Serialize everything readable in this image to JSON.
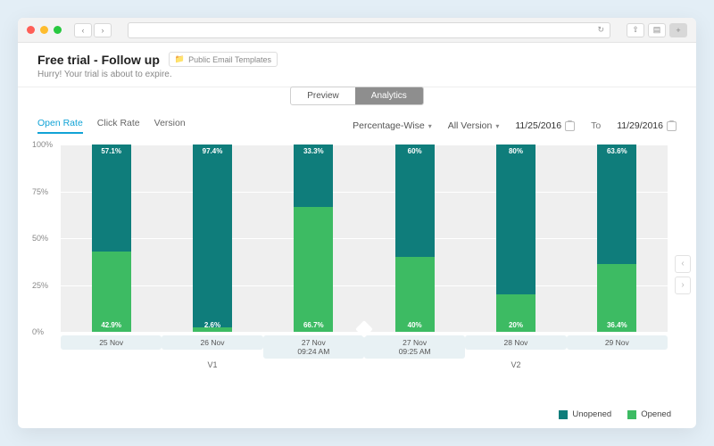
{
  "header": {
    "title": "Free trial - Follow up",
    "folder_label": "Public Email Templates",
    "subtitle": "Hurry! Your trial is about to expire."
  },
  "view_tabs": {
    "preview": "Preview",
    "analytics": "Analytics"
  },
  "metric_tabs": {
    "open_rate": "Open Rate",
    "click_rate": "Click Rate",
    "version": "Version"
  },
  "controls": {
    "mode": "Percentage-Wise",
    "version_filter": "All Version",
    "date_from": "11/25/2016",
    "to_label": "To",
    "date_to": "11/29/2016"
  },
  "yticks": [
    "100%",
    "75%",
    "50%",
    "25%",
    "0%"
  ],
  "legend": {
    "unopened": "Unopened",
    "opened": "Opened"
  },
  "versions": [
    "V1",
    "V2"
  ],
  "colors": {
    "unopened": "#0f7d7b",
    "opened": "#3dbb63"
  },
  "chart_data": {
    "type": "bar",
    "title": "",
    "xlabel": "",
    "ylabel": "",
    "ylim": [
      0,
      100
    ],
    "categories": [
      "25 Nov",
      "26 Nov",
      "27 Nov 09:24 AM",
      "27 Nov 09:25 AM",
      "28 Nov",
      "29 Nov"
    ],
    "category_version": [
      "V1",
      "V1",
      "V1",
      "V2",
      "V2",
      "V2"
    ],
    "series": [
      {
        "name": "Unopened",
        "values": [
          57.1,
          97.4,
          33.3,
          60.0,
          80.0,
          63.6
        ]
      },
      {
        "name": "Opened",
        "values": [
          42.9,
          2.6,
          66.7,
          40.0,
          20.0,
          36.4
        ]
      }
    ],
    "bar_labels": {
      "top": [
        "57.1%",
        "97.4%",
        "33.3%",
        "60%",
        "80%",
        "63.6%"
      ],
      "bottom": [
        "42.9%",
        "2.6%",
        "66.7%",
        "40%",
        "20%",
        "36.4%"
      ]
    }
  }
}
